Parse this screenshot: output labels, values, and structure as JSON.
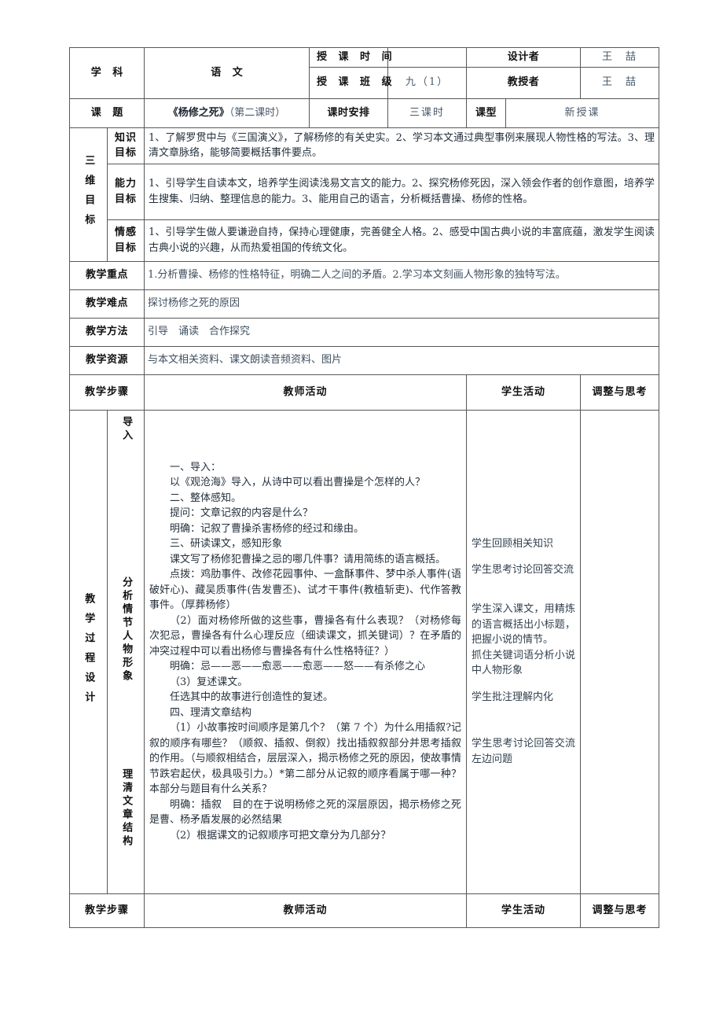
{
  "header": {
    "subject_label": "学 科",
    "subject_value": "语 文",
    "class_time_label": "授 课 时 间",
    "class_time_value": "",
    "designer_label": "设计者",
    "designer_value": "王　喆",
    "class_label": "授 课 班 级",
    "class_value": "九（1）",
    "teacher_label": "教授者",
    "teacher_value": "王　喆",
    "topic_label": "课 题",
    "topic_title": "《杨修之死》",
    "topic_sub": "（第二课时）",
    "period_label": "课时安排",
    "period_value": "三课时",
    "type_label": "课型",
    "type_value": "新授课"
  },
  "goals": {
    "section_label": "三维目标",
    "knowledge_label": "知识目标",
    "knowledge_text": "1、了解罗贯中与《三国演义》，了解杨修的有关史实。2、学习本文通过典型事例来展现人物性格的写法。3、理清文章脉络，能够简要概括事件要点。",
    "ability_label": "能力目标",
    "ability_text": "1、引导学生自读本文，培养学生阅读浅易文言文的能力。2、探究杨修死因，深入领会作者的创作意图，培养学生搜集、归纳、整理信息的能力。3、能用自己的语言，分析概括曹操、杨修的性格。",
    "emotion_label": "情感目标",
    "emotion_text": "1、引导学生做人要谦逊自持，保持心理健康，完善健全人格。2、感受中国古典小说的丰富底蕴，激发学生阅读古典小说的兴趣，从而热爱祖国的传统文化。"
  },
  "meta_rows": [
    {
      "label": "教学重点",
      "value": "1.分析曹操、杨修的性格特征，明确二人之间的矛盾。2.学习本文刻画人物形象的独特写法。"
    },
    {
      "label": "教学难点",
      "value": "探讨杨修之死的原因"
    },
    {
      "label": "教学方法",
      "value": "引导　诵读　合作探究"
    },
    {
      "label": "教学资源",
      "value": "与本文相关资料、课文朗读音频资料、图片"
    }
  ],
  "columns": {
    "step": "教学步骤",
    "teacher": "教师活动",
    "student": "学生活动",
    "notes": "调整与思考"
  },
  "process": {
    "section_label": "教学过程设计",
    "stage_intro": "导入",
    "stage_analyze": "分析情节人物形象",
    "stage_structure": "理清文章结构",
    "teacher_paras": [
      "一、导入：",
      "以《观沧海》导入，从诗中可以看出曹操是个怎样的人？",
      "二、整体感知。",
      "提问：文章记叙的内容是什么？",
      "明确：记叙了曹操杀害杨修的经过和缘由。",
      "三、研读课文，感知形象",
      "课文写了杨修犯曹操之忌的哪几件事？请用简练的语言概括。",
      "点拨：鸡肋事件、改修花园事仲、一盒酥事件、梦中杀人事件(语破奸心)、藏吴质事件(告发曹丕)、试才干事件(教植斩吏)、代作答教事件。（厚葬杨修）",
      "（2）面对杨修所做的这些事，曹操各有什么表现？（对杨修每次犯忌，曹操各有什么心理反应（细读课文，抓关键词）？在矛盾的冲突过程中可以看出杨修与曹操各有什么性格特征？）",
      "明确：忌——恶——愈恶——愈恶——怒——有杀修之心",
      "（3）复述课文。",
      "任选其中的故事进行创造性的复述。",
      "四、理清文章结构",
      "（1）小故事按时间顺序是第几个？（第 7 个）为什么用插叙?记叙的顺序有哪些？（顺叙、插叙、倒叙）找出插叙叙部分并思考插叙的作用。（与顺叙相结合，层层深入，揭示杨修之死的原因，使故事情节跌宕起伏，极具吸引力。）*第二部分从记叙的顺序看属于哪一种？本部分与题目有什么关系？",
      "明确：插叙　目的在于说明杨修之死的深层原因，揭示杨修之死是曹、杨矛盾发展的必然结果",
      "（2）根据课文的记叙顺序可把文章分为几部分？"
    ],
    "student_notes": [
      "学生回顾相关知识",
      "学生思考讨论回答交流",
      "学生深入课文，用精炼的语言概括出小标题，把握小说的情节。",
      "抓住关键词语分析小说中人物形象",
      "学生批注理解内化",
      "学生思考讨论回答交流左边问题"
    ],
    "notes_value": ""
  },
  "footer": {
    "step": "教学步骤",
    "teacher": "教师活动",
    "student": "学生活动",
    "notes": "调整与思考"
  }
}
